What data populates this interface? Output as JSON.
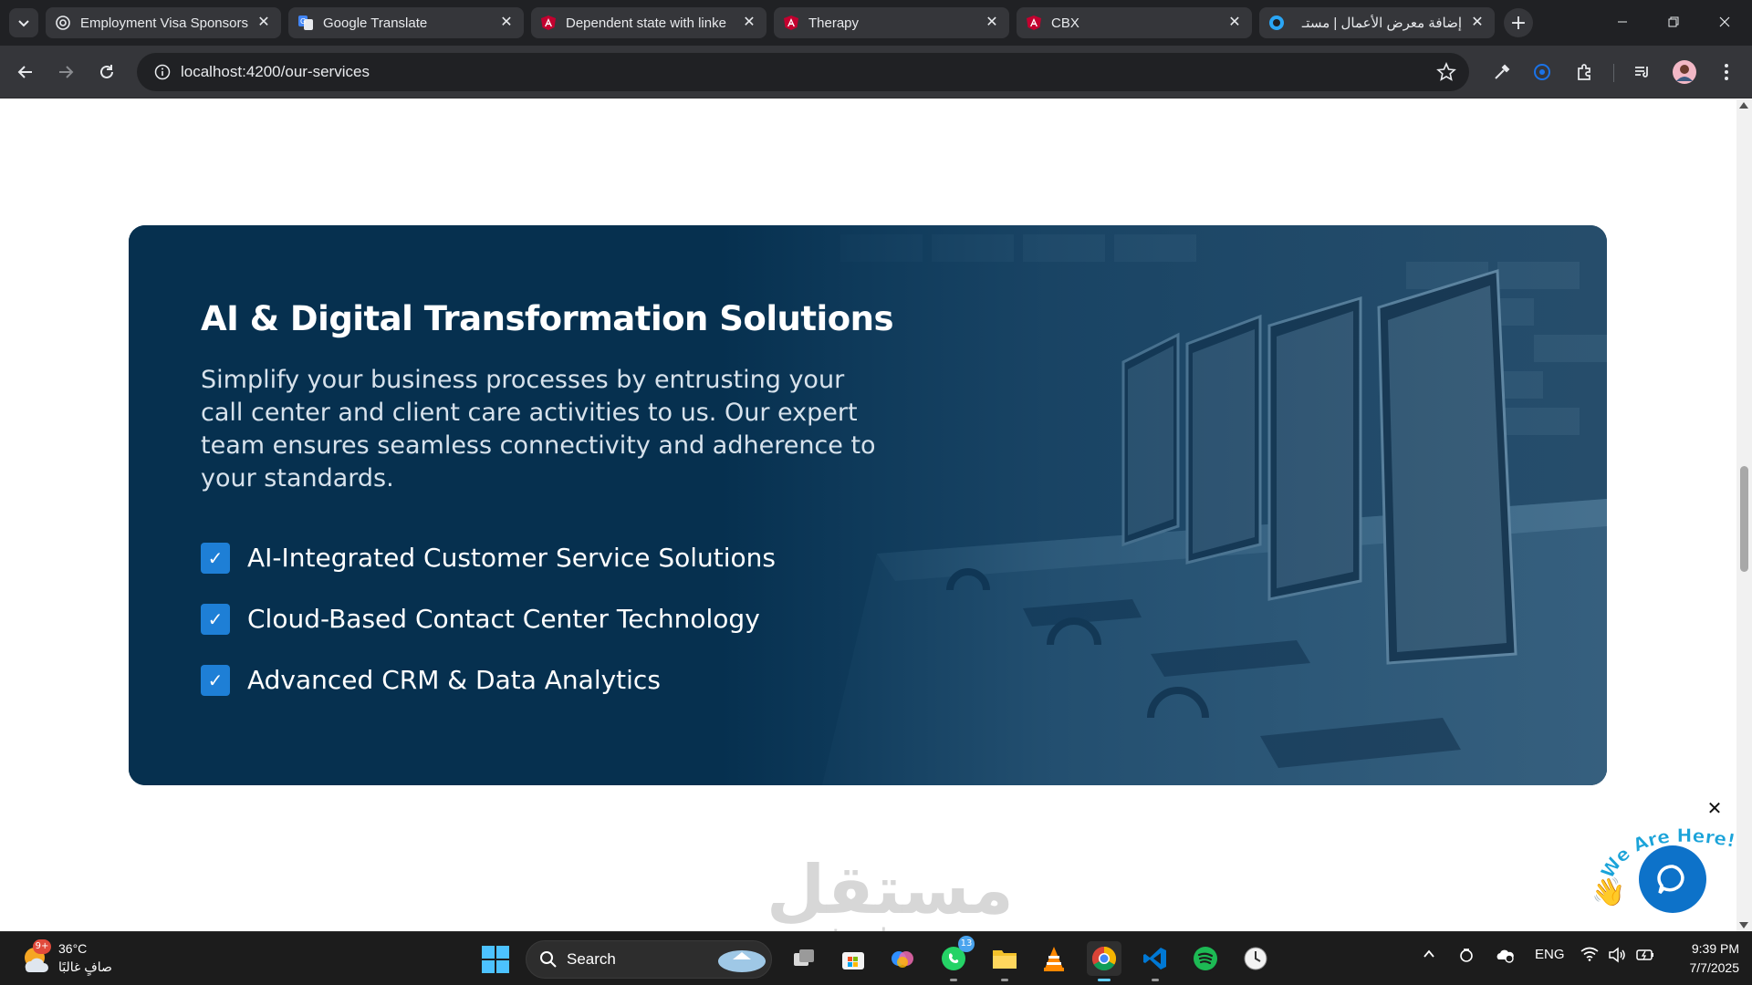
{
  "browser": {
    "tabs": [
      {
        "title": "Employment Visa Sponsors",
        "favicon": "globe-icon",
        "active": false
      },
      {
        "title": "Google Translate",
        "favicon": "translate-icon",
        "active": false
      },
      {
        "title": "Dependent state with linke",
        "favicon": "angular-icon",
        "active": false
      },
      {
        "title": "Therapy",
        "favicon": "angular-icon",
        "active": false
      },
      {
        "title": "CBX",
        "favicon": "angular-icon",
        "active": true
      },
      {
        "title": "إضافة معرض الأعمال | مستـ",
        "favicon": "mostaql-icon",
        "active": false
      }
    ],
    "url": "localhost:4200/our-services"
  },
  "page": {
    "card": {
      "title": "AI & Digital Transformation Solutions",
      "description": "Simplify your business processes by entrusting your call center and client care activities to us. Our expert team ensures seamless connectivity and adherence to your standards.",
      "features": [
        "AI-Integrated Customer Service Solutions",
        "Cloud-Based Contact Center Technology",
        "Advanced CRM & Data Analytics"
      ],
      "check_glyph": "✓"
    },
    "chat_widget": {
      "tagline": "We Are Here!",
      "close_glyph": "✕"
    },
    "watermark": {
      "arabic": "مستقل",
      "latin": "mostaql.com"
    }
  },
  "taskbar": {
    "weather": {
      "temp": "36°C",
      "condition": "صافٍ غالبًا",
      "badge": "9+"
    },
    "search_label": "Search",
    "whatsapp_badge": "13",
    "tray": {
      "language": "ENG"
    },
    "clock": {
      "time": "9:39 PM",
      "date": "7/7/2025"
    }
  },
  "colors": {
    "card_bg": "#06304f",
    "accent_blue": "#1e7fd6",
    "chat_blue": "#0d72c9"
  }
}
